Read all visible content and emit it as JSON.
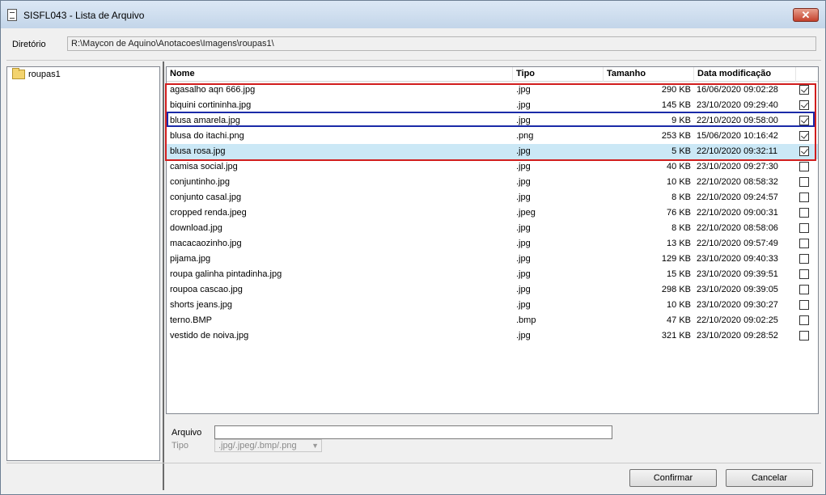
{
  "window": {
    "title": "SISFL043 - Lista de Arquivo",
    "close_label": "✕"
  },
  "directory": {
    "label": "Diretório",
    "value": "R:\\Maycon de Aquino\\Anotacoes\\Imagens\\roupas1\\"
  },
  "tree": {
    "items": [
      {
        "label": "roupas1"
      }
    ]
  },
  "list": {
    "columns": [
      "Nome",
      "Tipo",
      "Tamanho",
      "Data modificação"
    ],
    "rows": [
      {
        "name": "agasalho aqn 666.jpg",
        "tipo": ".jpg",
        "size": "290 KB",
        "date": "16/06/2020 09:02:28",
        "checked": true
      },
      {
        "name": "biquini cortininha.jpg",
        "tipo": ".jpg",
        "size": "145 KB",
        "date": "23/10/2020 09:29:40",
        "checked": true
      },
      {
        "name": "blusa amarela.jpg",
        "tipo": ".jpg",
        "size": "9 KB",
        "date": "22/10/2020 09:58:00",
        "checked": true
      },
      {
        "name": "blusa do itachi.png",
        "tipo": ".png",
        "size": "253 KB",
        "date": "15/06/2020 10:16:42",
        "checked": true
      },
      {
        "name": "blusa rosa.jpg",
        "tipo": ".jpg",
        "size": "5 KB",
        "date": "22/10/2020 09:32:11",
        "checked": true,
        "selected": true
      },
      {
        "name": "camisa social.jpg",
        "tipo": ".jpg",
        "size": "40 KB",
        "date": "23/10/2020 09:27:30",
        "checked": false
      },
      {
        "name": "conjuntinho.jpg",
        "tipo": ".jpg",
        "size": "10 KB",
        "date": "22/10/2020 08:58:32",
        "checked": false
      },
      {
        "name": "conjunto casal.jpg",
        "tipo": ".jpg",
        "size": "8 KB",
        "date": "22/10/2020 09:24:57",
        "checked": false
      },
      {
        "name": "cropped renda.jpeg",
        "tipo": ".jpeg",
        "size": "76 KB",
        "date": "22/10/2020 09:00:31",
        "checked": false
      },
      {
        "name": "download.jpg",
        "tipo": ".jpg",
        "size": "8 KB",
        "date": "22/10/2020 08:58:06",
        "checked": false
      },
      {
        "name": "macacaozinho.jpg",
        "tipo": ".jpg",
        "size": "13 KB",
        "date": "22/10/2020 09:57:49",
        "checked": false
      },
      {
        "name": "pijama.jpg",
        "tipo": ".jpg",
        "size": "129 KB",
        "date": "23/10/2020 09:40:33",
        "checked": false
      },
      {
        "name": "roupa galinha pintadinha.jpg",
        "tipo": ".jpg",
        "size": "15 KB",
        "date": "23/10/2020 09:39:51",
        "checked": false
      },
      {
        "name": "roupoa cascao.jpg",
        "tipo": ".jpg",
        "size": "298 KB",
        "date": "23/10/2020 09:39:05",
        "checked": false
      },
      {
        "name": "shorts jeans.jpg",
        "tipo": ".jpg",
        "size": "10 KB",
        "date": "23/10/2020 09:30:27",
        "checked": false
      },
      {
        "name": "terno.BMP",
        "tipo": ".bmp",
        "size": "47 KB",
        "date": "22/10/2020 09:02:25",
        "checked": false
      },
      {
        "name": "vestido de noiva.jpg",
        "tipo": ".jpg",
        "size": "321 KB",
        "date": "23/10/2020 09:28:52",
        "checked": false
      }
    ]
  },
  "arquivo": {
    "label": "Arquivo",
    "value": ""
  },
  "tipo": {
    "label": "Tipo",
    "value": ".jpg/.jpeg/.bmp/.png"
  },
  "buttons": {
    "confirm": "Confirmar",
    "cancel": "Cancelar"
  },
  "colors": {
    "selection": "#cbe8f6",
    "highlight_red": "#d11d1d",
    "highlight_blue": "#1a2aa8"
  }
}
